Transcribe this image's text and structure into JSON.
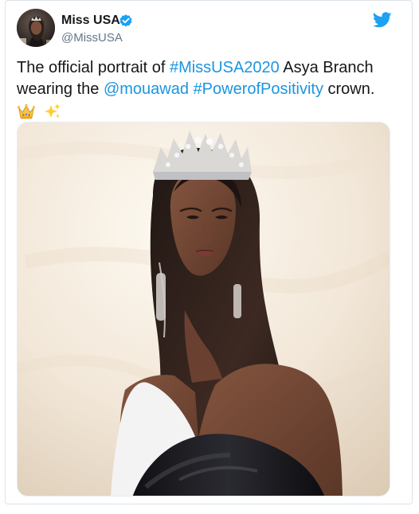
{
  "author": {
    "name": "Miss USA",
    "handle": "@MissUSA",
    "verified": true,
    "avatar_icon": "profile-avatar"
  },
  "brand": {
    "icon": "twitter-bird-icon",
    "color": "#1da1f2"
  },
  "tweet": {
    "text_1": "The official portrait of ",
    "hashtag_1": "#MissUSA2020",
    "text_2": " Asya Branch",
    "text_3": "wearing the ",
    "mention_1": "@mouawad",
    "text_4": " ",
    "hashtag_2": "#PowerofPositivity",
    "text_5": " crown.",
    "emoji_1": "crown-emoji",
    "emoji_2": "sparkles-emoji"
  },
  "media": {
    "type": "portrait-photo",
    "subject_icon": "woman-wearing-crown"
  },
  "colors": {
    "link": "#1b95e0",
    "text": "#14171a",
    "secondary": "#657786",
    "verified": "#1da1f2"
  }
}
